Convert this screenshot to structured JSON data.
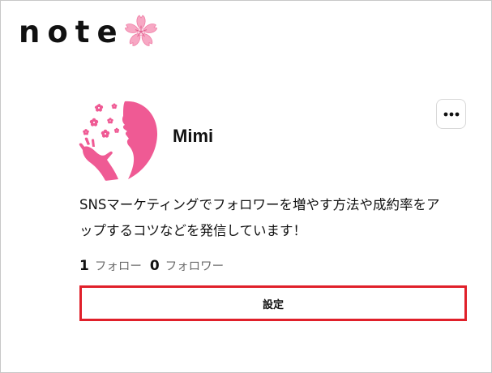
{
  "header": {
    "logo_text": "note",
    "logo_icon": "sakura-icon"
  },
  "profile": {
    "avatar_icon": "woman-silhouette-with-flowers",
    "name": "Mimi",
    "more_icon": "ellipsis-icon",
    "bio_line1": "SNSマーケティングでフォロワーを増やす方法や成約率をア",
    "bio_line2": "ップするコツなどを発信しています！",
    "following_count": "1",
    "following_label": "フォロー",
    "followers_count": "0",
    "followers_label": "フォロワー",
    "settings_label": "設定"
  },
  "colors": {
    "accent_pink": "#ef5a94",
    "highlight_red": "#e0202a",
    "sakura_pink": "#f7a8c4"
  }
}
